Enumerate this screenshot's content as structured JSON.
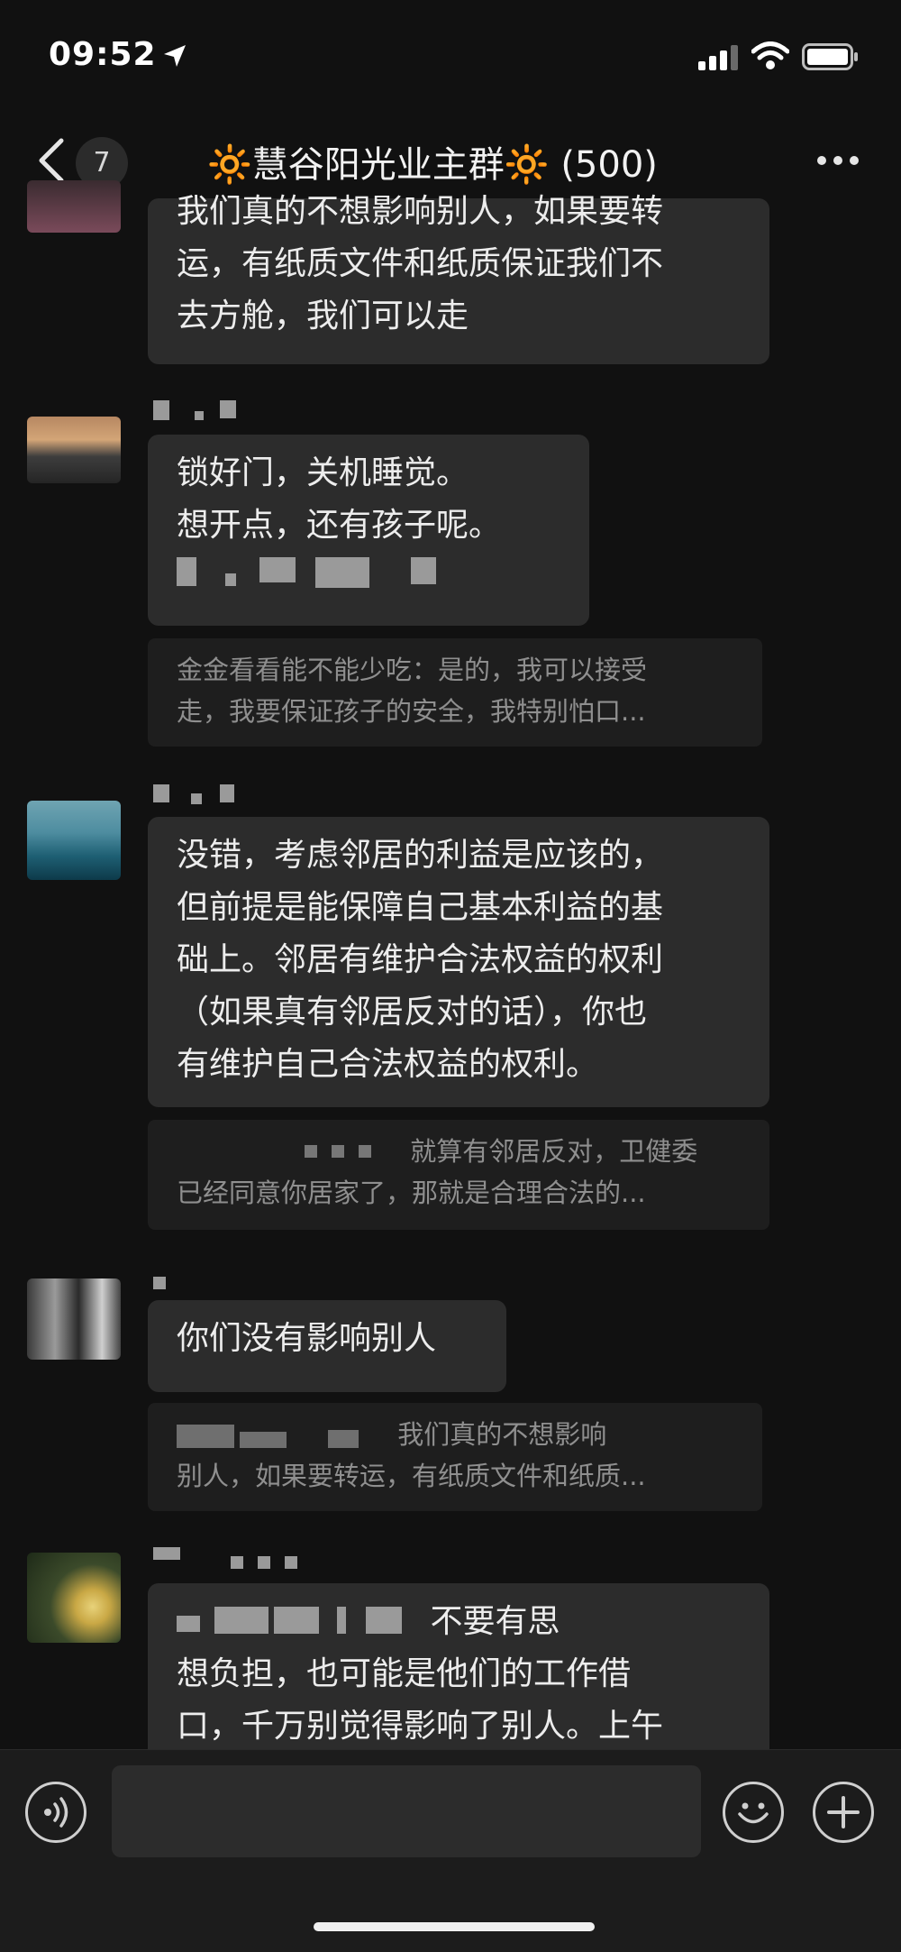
{
  "status_bar": {
    "time": "09:52"
  },
  "header": {
    "back_badge": "7",
    "title": "🔆慧谷阳光业主群🔆 (500)"
  },
  "messages": [
    {
      "lines": [
        "我们真的不想影响别人，如果要转",
        "运，有纸质文件和纸质保证我们不",
        "去方舱，我们可以走"
      ]
    },
    {
      "lines": [
        "锁好门，关机睡觉。",
        "想开点，还有孩子呢。"
      ],
      "quote_lines": [
        "金金看看能不能少吃：是的，我可以接受",
        "走，我要保证孩子的安全，我特别怕口..."
      ]
    },
    {
      "lines": [
        "没错，考虑邻居的利益是应该的，",
        "但前提是能保障自己基本利益的基",
        "础上。邻居有维护合法权益的权利",
        "（如果真有邻居反对的话），你也",
        "有维护自己合法权益的权利。"
      ],
      "quote_lines": [
        "就算有邻居反对，卫健委",
        "已经同意你居家了，那就是合理合法的..."
      ]
    },
    {
      "lines": [
        "你们没有影响别人"
      ],
      "quote_lines": [
        "我们真的不想影响",
        "别人，如果要转运，有纸质文件和纸质..."
      ]
    },
    {
      "lines": [
        "不要有思",
        "想负担，也可能是他们的工作借",
        "口，千万别觉得影响了别人。上午"
      ]
    }
  ],
  "icons": {
    "back": "chevron-left-icon",
    "more": "more-dots-icon",
    "voice": "voice-icon",
    "emoji": "emoji-icon",
    "plus": "plus-icon",
    "location": "location-arrow-icon",
    "signal": "signal-icon",
    "wifi": "wifi-icon",
    "battery": "battery-icon"
  },
  "colors": {
    "background": "#111111",
    "bubble": "#2c2c2c",
    "quote": "#1e1e1e",
    "text": "#ededed",
    "muted": "#8f8f8f"
  }
}
